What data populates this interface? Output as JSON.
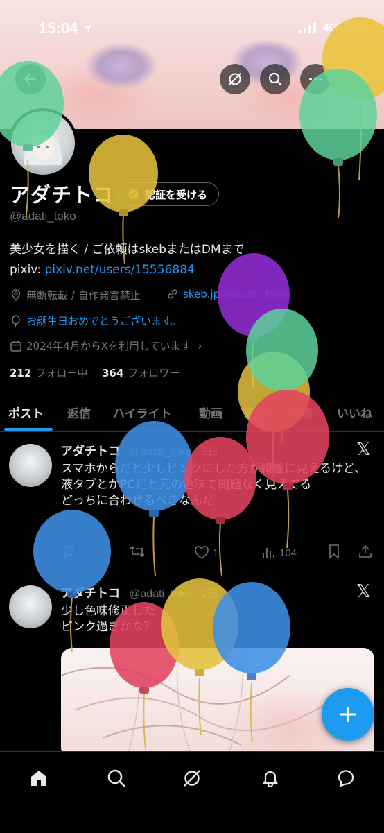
{
  "status": {
    "time": "15:04",
    "network": "4G"
  },
  "profile": {
    "name": "アダチトコ",
    "verify_label": "認証を受ける",
    "handle": "@adati_toko",
    "bio_line1": "美少女を描く / ご依頼はskebまたはDMまで",
    "bio_pixiv_prefix": "pixiv: ",
    "bio_pixiv_link": "pixiv.net/users/15556884",
    "location": "無断転載 / 自作発言禁止",
    "website": "skeb.jp/@adati_toko",
    "birthday": "お誕生日おめでとうございます。",
    "joined": "2024年4月からXを利用しています",
    "following_count": "212",
    "following_label": "フォロー中",
    "followers_count": "364",
    "followers_label": "フォロワー"
  },
  "tabs": [
    "ポスト",
    "返信",
    "ハイライト",
    "動画",
    "画像",
    "記事",
    "いいね"
  ],
  "posts": [
    {
      "name": "アダチトコ",
      "meta": "@adati_toko · 2日",
      "text": "スマホからだと少しピンクにした方が綺麗に見えるけど、液タブとかPCだと元の色味で問題なく見えてる\nどっちに合わせるべきなんだ",
      "likes": "1",
      "views": "104"
    },
    {
      "name": "アダチトコ",
      "meta": "@adati_toko · 2日",
      "text": "少し色味修正した\nピンク過ぎかな？"
    }
  ],
  "colors": {
    "accent": "#1d9bf0",
    "background": "#000000",
    "text": "#e7e9ea",
    "muted": "#71767b"
  }
}
